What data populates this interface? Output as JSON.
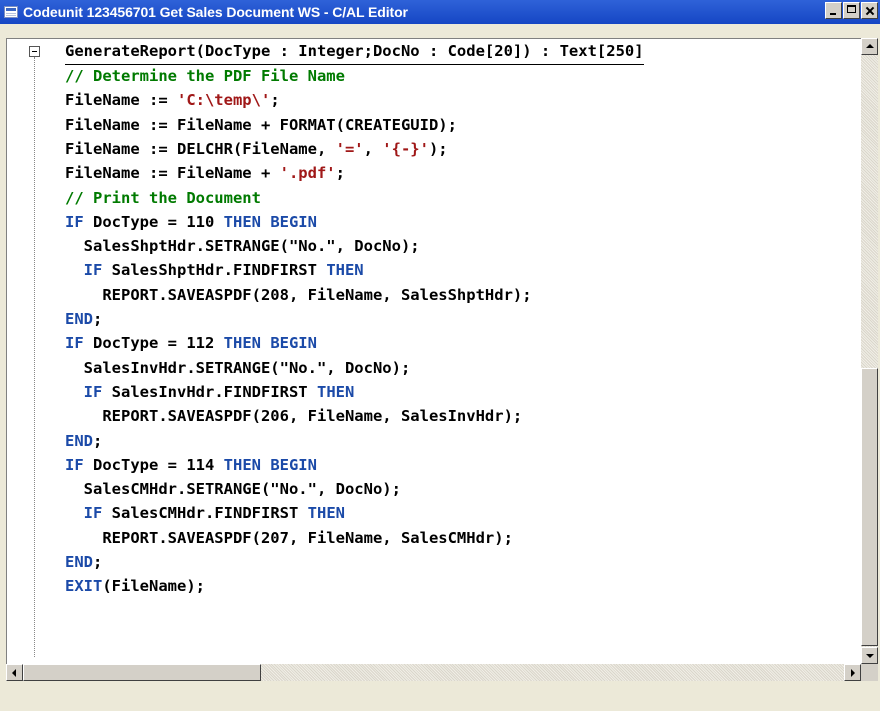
{
  "window": {
    "title": "Codeunit 123456701 Get Sales Document WS - C/AL Editor",
    "icon": "table-icon"
  },
  "code": {
    "heading": "GenerateReport(DocType : Integer;DocNo : Code[20]) : Text[250]",
    "lines": [
      [
        {
          "t": "// Determine the PDF File Name",
          "c": "cmt"
        }
      ],
      [
        {
          "t": "FileName := "
        },
        {
          "t": "'C:\\temp\\'",
          "c": "str"
        },
        {
          "t": ";"
        }
      ],
      [
        {
          "t": "FileName := FileName + FORMAT(CREATEGUID);"
        }
      ],
      [
        {
          "t": "FileName := DELCHR(FileName, "
        },
        {
          "t": "'='",
          "c": "str"
        },
        {
          "t": ", "
        },
        {
          "t": "'{-}'",
          "c": "str"
        },
        {
          "t": ");"
        }
      ],
      [
        {
          "t": "FileName := FileName + "
        },
        {
          "t": "'.pdf'",
          "c": "str"
        },
        {
          "t": ";"
        }
      ],
      [
        {
          "t": "// Print the Document",
          "c": "cmt"
        }
      ],
      [
        {
          "t": "IF",
          "c": "kw"
        },
        {
          "t": " DocType = 110 "
        },
        {
          "t": "THEN BEGIN",
          "c": "kw"
        }
      ],
      [
        {
          "t": "  SalesShptHdr.SETRANGE(\"No.\", DocNo);"
        }
      ],
      [
        {
          "t": "  "
        },
        {
          "t": "IF",
          "c": "kw"
        },
        {
          "t": " SalesShptHdr.FINDFIRST "
        },
        {
          "t": "THEN",
          "c": "kw"
        }
      ],
      [
        {
          "t": "    REPORT.SAVEASPDF(208, FileName, SalesShptHdr);"
        }
      ],
      [
        {
          "t": "END",
          "c": "kw"
        },
        {
          "t": ";"
        }
      ],
      [
        {
          "t": "IF",
          "c": "kw"
        },
        {
          "t": " DocType = 112 "
        },
        {
          "t": "THEN BEGIN",
          "c": "kw"
        }
      ],
      [
        {
          "t": "  SalesInvHdr.SETRANGE(\"No.\", DocNo);"
        }
      ],
      [
        {
          "t": "  "
        },
        {
          "t": "IF",
          "c": "kw"
        },
        {
          "t": " SalesInvHdr.FINDFIRST "
        },
        {
          "t": "THEN",
          "c": "kw"
        }
      ],
      [
        {
          "t": "    REPORT.SAVEASPDF(206, FileName, SalesInvHdr);"
        }
      ],
      [
        {
          "t": "END",
          "c": "kw"
        },
        {
          "t": ";"
        }
      ],
      [
        {
          "t": "IF",
          "c": "kw"
        },
        {
          "t": " DocType = 114 "
        },
        {
          "t": "THEN BEGIN",
          "c": "kw"
        }
      ],
      [
        {
          "t": "  SalesCMHdr.SETRANGE(\"No.\", DocNo);"
        }
      ],
      [
        {
          "t": "  "
        },
        {
          "t": "IF",
          "c": "kw"
        },
        {
          "t": " SalesCMHdr.FINDFIRST "
        },
        {
          "t": "THEN",
          "c": "kw"
        }
      ],
      [
        {
          "t": "    REPORT.SAVEASPDF(207, FileName, SalesCMHdr);"
        }
      ],
      [
        {
          "t": "END",
          "c": "kw"
        },
        {
          "t": ";"
        }
      ],
      [
        {
          "t": "EXIT",
          "c": "kw"
        },
        {
          "t": "(FileName);"
        }
      ]
    ]
  },
  "colors": {
    "keyword": "#1b4aa8",
    "string": "#a01818",
    "comment": "#007a00",
    "titlebar": "#1f4fcf"
  }
}
